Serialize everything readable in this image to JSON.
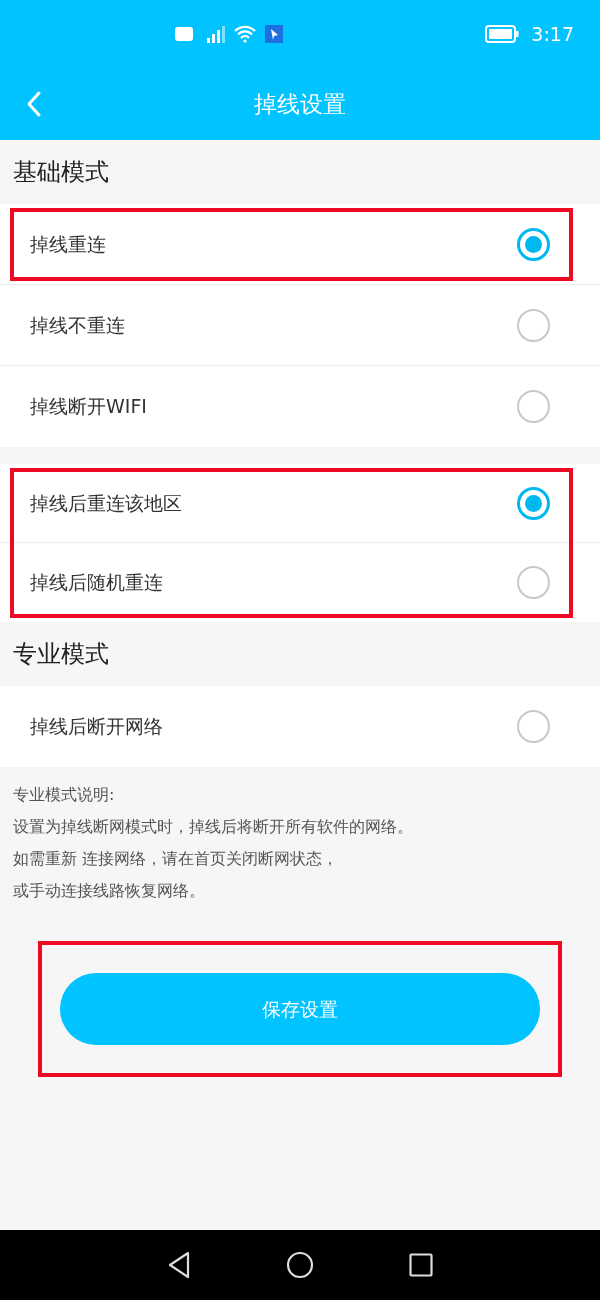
{
  "status_bar": {
    "time": "3:17"
  },
  "header": {
    "title": "掉线设置"
  },
  "sections": [
    {
      "heading": "基础模式",
      "cards": [
        {
          "blocks": [
            {
              "highlighted": true,
              "options": [
                {
                  "label": "掉线重连",
                  "selected": true
                }
              ]
            },
            {
              "highlighted": false,
              "options": [
                {
                  "label": "掉线不重连",
                  "selected": false
                },
                {
                  "label": "掉线断开WIFI",
                  "selected": false
                }
              ]
            }
          ]
        },
        {
          "blocks": [
            {
              "highlighted": true,
              "options": [
                {
                  "label": "掉线后重连该地区",
                  "selected": true
                },
                {
                  "label": "掉线后随机重连",
                  "selected": false
                }
              ]
            }
          ]
        }
      ]
    },
    {
      "heading": "专业模式",
      "cards": [
        {
          "blocks": [
            {
              "highlighted": false,
              "options": [
                {
                  "label": "掉线后断开网络",
                  "selected": false
                }
              ]
            }
          ]
        }
      ]
    }
  ],
  "note": [
    "专业模式说明:",
    "设置为掉线断网模式时，掉线后将断开所有软件的网络。",
    "如需重新 连接网络，请在首页关闭断网状态，",
    "或手动连接线路恢复网络。"
  ],
  "save_button": {
    "label": "保存设置",
    "highlighted": true
  }
}
